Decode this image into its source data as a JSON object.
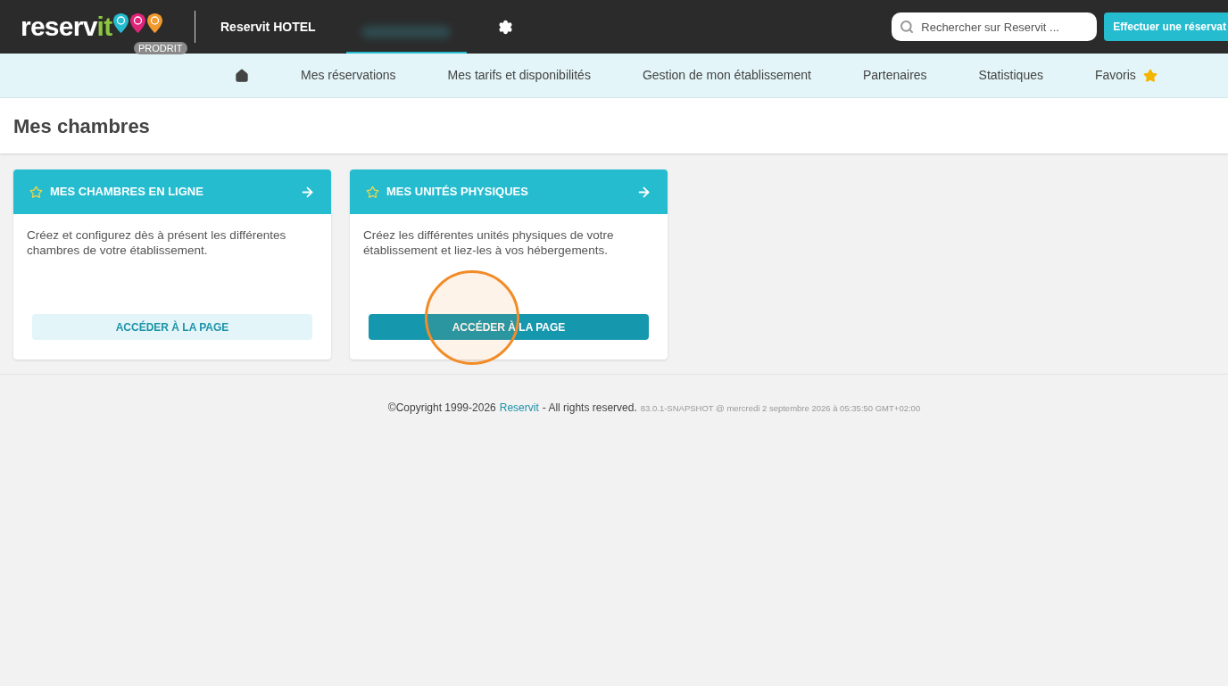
{
  "topbar": {
    "logo": {
      "main": "reserv",
      "accent": "it",
      "badge": "PRODRIT"
    },
    "hotel": "Reservit HOTEL",
    "search": {
      "placeholder": "Rechercher sur Reservit ..."
    },
    "action_button": "Effectuer une réservat"
  },
  "nav": {
    "items": [
      {
        "kind": "home"
      },
      {
        "kind": "link",
        "label": "Mes réservations"
      },
      {
        "kind": "link",
        "label": "Mes tarifs et disponibilités"
      },
      {
        "kind": "link",
        "label": "Gestion de mon établissement"
      },
      {
        "kind": "link",
        "label": "Partenaires"
      },
      {
        "kind": "link",
        "label": "Statistiques"
      },
      {
        "kind": "favorites",
        "label": "Favoris"
      }
    ]
  },
  "page_title": "Mes chambres",
  "cards": [
    {
      "title": "MES CHAMBRES EN LIGNE",
      "description": "Créez et configurez dès à présent les différentes chambres de votre établissement.",
      "button": "ACCÉDER À LA PAGE",
      "hovered": false,
      "clicked": false
    },
    {
      "title": "MES UNITÉS PHYSIQUES",
      "description": "Créez les différentes unités physiques de votre établissement et liez-les à vos hébergements.",
      "button": "ACCÉDER À LA PAGE",
      "hovered": true,
      "clicked": true
    }
  ],
  "footer": {
    "copyright": "©Copyright 1999-2026",
    "link": "Reservit",
    "rights": "- All rights reserved.",
    "version": "83.0.1-SNAPSHOT @ mercredi 2 septembre 2026 à 05:35:50 GMT+02:00"
  }
}
